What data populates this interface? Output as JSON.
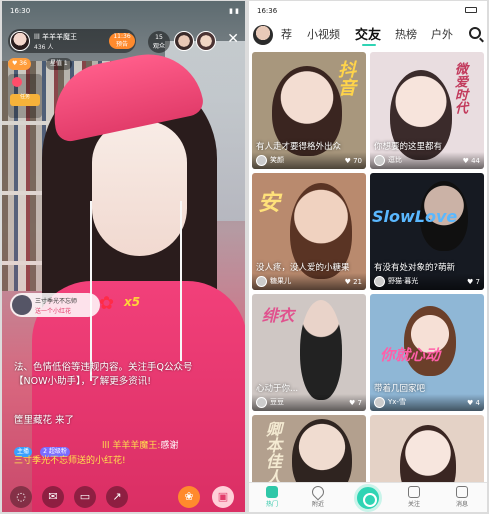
{
  "live": {
    "status_time": "16:30",
    "host": {
      "name": "lll 羊羊羊魔王",
      "id": "436 人"
    },
    "follow_label": "11:36\n预告",
    "viewer_count": "15\n观众",
    "coins": "36",
    "coins_label": "星值 1",
    "gift_banner": {
      "user": "三寸季光不忘师",
      "gift": "送一个小红花"
    },
    "gift_multiplier": "x5",
    "system_message": "法、色情低俗等违规内容。关注手Q公众号【NOW小助手】，了解更多资讯!",
    "join_message": "筐里藏花 来了",
    "chat": {
      "badges": [
        "主播",
        "2 超级粉"
      ],
      "user": "lll 羊羊羊魔王:",
      "msg_tail": "感谢",
      "line2": "三寸季光不忘师送的小红花!"
    },
    "bottom_icons": [
      "chat-icon",
      "mail-icon",
      "message-icon",
      "share-icon",
      "gift-icon",
      "giftbox-icon"
    ]
  },
  "feed": {
    "status_time": "16:36",
    "tabs": [
      {
        "label": "荐"
      },
      {
        "label": "小视频"
      },
      {
        "label": "交友"
      },
      {
        "label": "热榜"
      },
      {
        "label": "户外"
      }
    ],
    "cards": [
      {
        "caption": "有人走才要得格外出众",
        "name": "笑颜 ",
        "count": "70",
        "bg": "#a8977d",
        "deco": "抖音",
        "deco_color": "#ffd44a"
      },
      {
        "caption": "你想要的这里都有",
        "name": "逗比",
        "count": "44",
        "bg": "#e9dde0",
        "deco": "微爱时代",
        "deco_color": "#c23a5c"
      },
      {
        "caption": "没人疼，没人爱的小糖果",
        "name": "糖果儿",
        "count": "21",
        "bg": "#b98a6e",
        "deco": "安",
        "deco_color": "#ffe17a"
      },
      {
        "caption": "有没有处对象的?萌新",
        "name": "野猫·暮光",
        "count": "7",
        "bg": "#161a22",
        "deco": "SlowLove",
        "deco_color": "#5ab8ff"
      },
      {
        "caption": "心动于你...",
        "name": "豆豆",
        "count": "7",
        "bg": "#cfc7c4",
        "deco": "绯衣",
        "deco_color": "#e0528e"
      },
      {
        "caption": "带着几回家吧",
        "name": "Yx-雪",
        "count": "4",
        "bg": "#8fb7d6",
        "deco": "你就心动",
        "deco_color": "#ff5fa8"
      },
      {
        "caption": "",
        "name": "",
        "count": "",
        "bg": "#b3a08e",
        "deco": "卿本佳人",
        "deco_color": "#f4ead2"
      },
      {
        "caption": "",
        "name": "",
        "count": "",
        "bg": "#e4d2c6",
        "deco": "",
        "deco_color": "#ffffff"
      }
    ],
    "nav": [
      {
        "label": "热门"
      },
      {
        "label": "附近"
      },
      {
        "label": "关注"
      },
      {
        "label": "消息"
      }
    ]
  }
}
